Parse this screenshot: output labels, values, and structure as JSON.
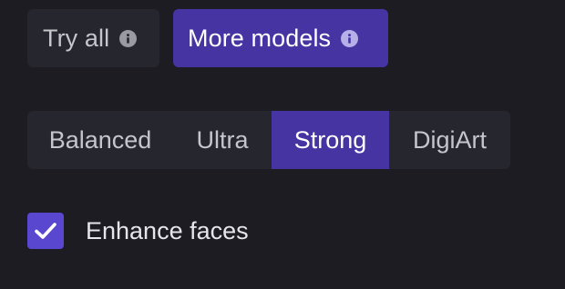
{
  "model_buttons": {
    "try_all": {
      "label": "Try all",
      "icon": "info-icon"
    },
    "more_models": {
      "label": "More models",
      "icon": "info-icon"
    }
  },
  "mode_selector": {
    "items": [
      "Balanced",
      "Ultra",
      "Strong",
      "DigiArt"
    ],
    "selected": "Strong"
  },
  "enhance_faces": {
    "label": "Enhance faces",
    "checked": true,
    "icon": "check-icon"
  },
  "colors": {
    "background": "#1c1c22",
    "surface": "#26262e",
    "accent": "#4534a1",
    "checkbox": "#5947cf"
  }
}
